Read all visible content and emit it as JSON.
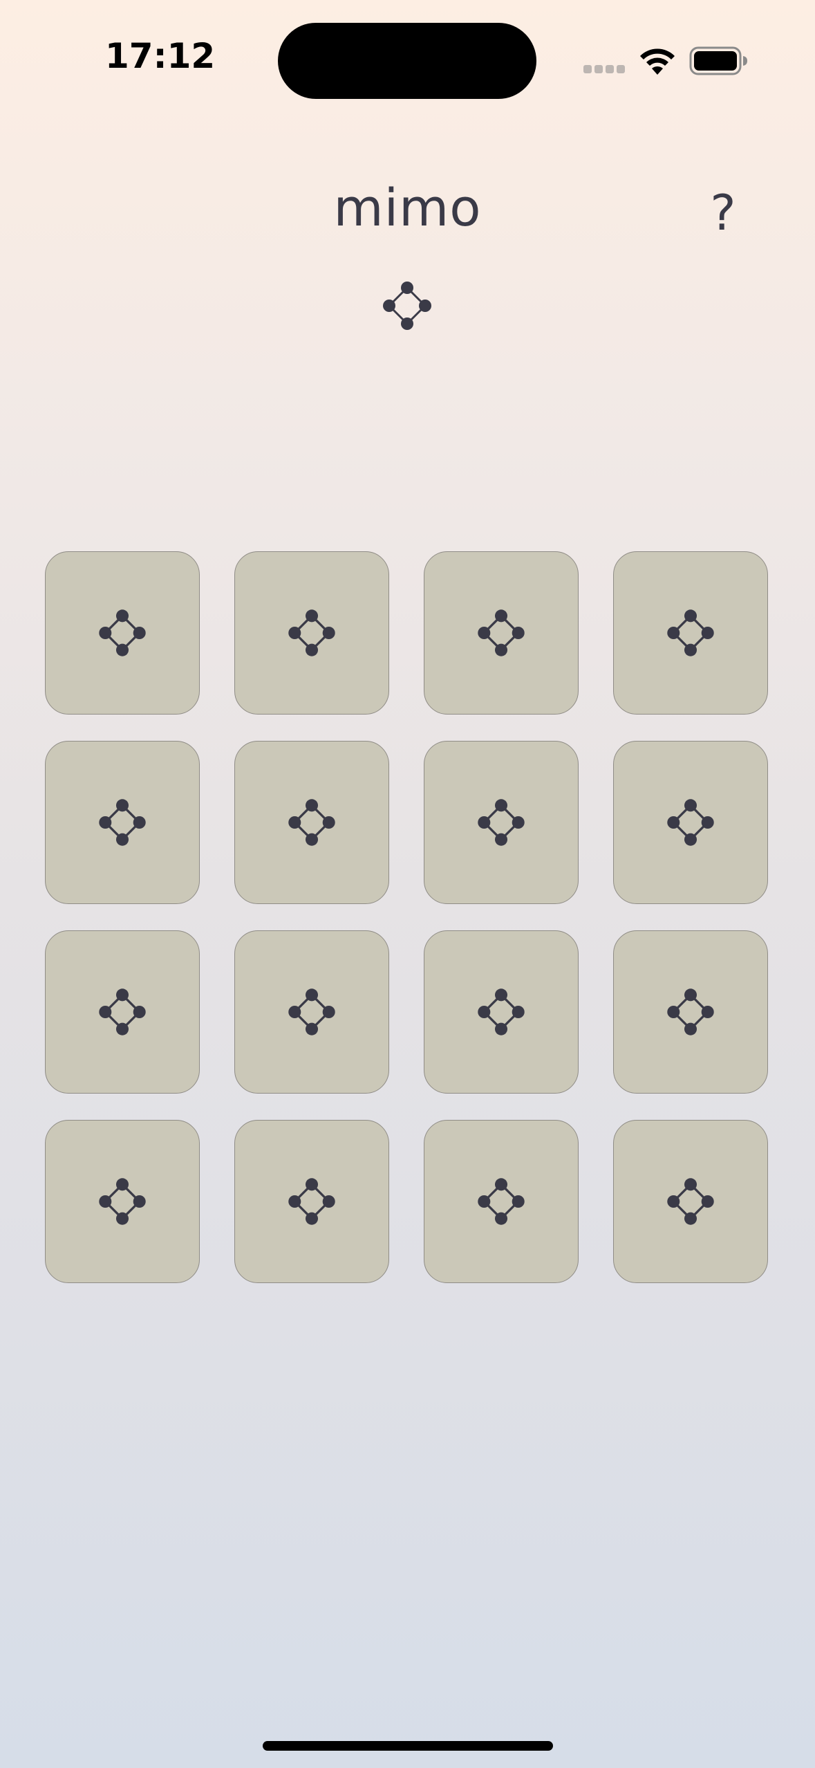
{
  "status_bar": {
    "time": "17:12",
    "signal_icon": "signal-dots-icon",
    "wifi_icon": "wifi-icon",
    "battery_icon": "battery-icon"
  },
  "header": {
    "title": "mimo",
    "help_label": "?",
    "logo_icon": "diamond-nodes-icon"
  },
  "board": {
    "rows": 4,
    "columns": 4,
    "card_face_icon": "diamond-nodes-icon",
    "cards": [
      {
        "state": "face-down"
      },
      {
        "state": "face-down"
      },
      {
        "state": "face-down"
      },
      {
        "state": "face-down"
      },
      {
        "state": "face-down"
      },
      {
        "state": "face-down"
      },
      {
        "state": "face-down"
      },
      {
        "state": "face-down"
      },
      {
        "state": "face-down"
      },
      {
        "state": "face-down"
      },
      {
        "state": "face-down"
      },
      {
        "state": "face-down"
      },
      {
        "state": "face-down"
      },
      {
        "state": "face-down"
      },
      {
        "state": "face-down"
      },
      {
        "state": "face-down"
      }
    ]
  },
  "colors": {
    "background_top": "#fdeee3",
    "background_bottom": "#d6dde8",
    "card_fill": "#cbc8b8",
    "card_border": "#8f8c86",
    "ink": "#3a3a47"
  }
}
